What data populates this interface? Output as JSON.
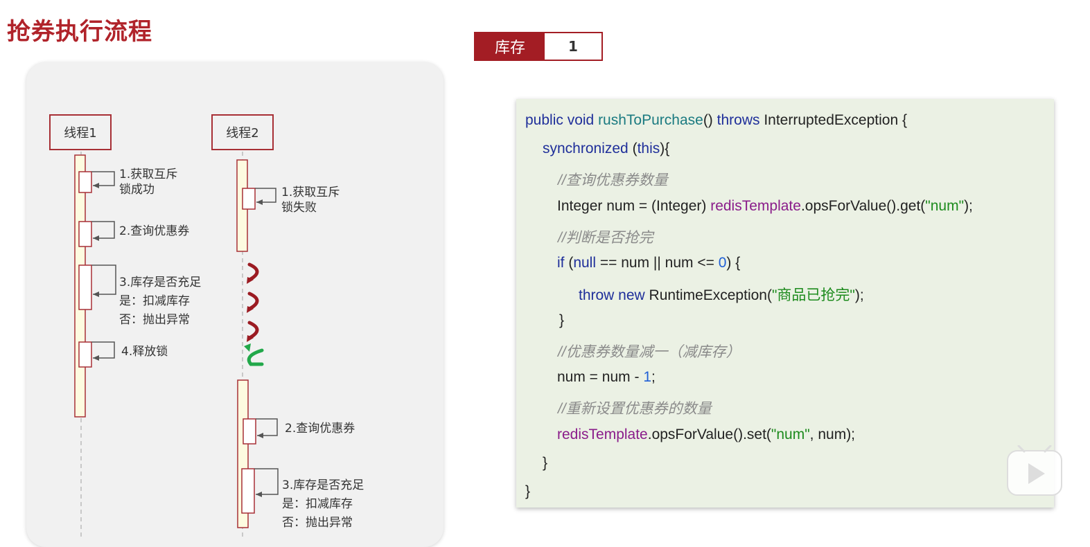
{
  "page": {
    "title": "抢券执行流程"
  },
  "stock": {
    "label": "库存",
    "value": "1"
  },
  "threads": [
    {
      "name": "线程1",
      "steps": [
        {
          "line1": "1.获取互斥",
          "line2": "锁成功"
        },
        {
          "line1": "2.查询优惠券"
        },
        {
          "line1": "3.库存是否充足",
          "line2": "是：扣减库存",
          "line3": "否：抛出异常"
        },
        {
          "line1": "4.释放锁"
        }
      ]
    },
    {
      "name": "线程2",
      "steps": [
        {
          "line1": "1.获取互斥",
          "line2": "锁失败"
        },
        {
          "line1": "2.查询优惠券"
        },
        {
          "line1": "3.库存是否充足",
          "line2": "是：扣减库存",
          "line3": "否：抛出异常"
        }
      ]
    }
  ],
  "colors": {
    "accent": "#a31d24",
    "wait_arrow": "#9b1b22",
    "retry_arrow": "#22a84a",
    "lifeline_fill": "#fdfbe0",
    "code_bg": "#ebf1e4"
  },
  "code": {
    "l1": {
      "kw1": "public void ",
      "fn": "rushToPurchase",
      "p1": "() ",
      "kw2": "throws",
      "p2": " InterruptedException {"
    },
    "l2": {
      "kw": "synchronized",
      "p1": " (",
      "kw2": "this",
      "p2": "){"
    },
    "l3": {
      "cmt": "//查询优惠券数量"
    },
    "l4": {
      "p1": "Integer num = (Integer) ",
      "field": "redisTemplate",
      "p2": ".opsForValue().get(",
      "str": "\"num\"",
      "p3": ");"
    },
    "l5": {
      "cmt": "//判断是否抢完"
    },
    "l6": {
      "kw": "if",
      "p1": " (",
      "kw2": "null",
      "p2": " == num || num <= ",
      "num": "0",
      "p3": ") {"
    },
    "l7": {
      "kw": "throw new",
      "p1": " RuntimeException(",
      "str": "\"商品已抢完\"",
      "p2": ");"
    },
    "l8": {
      "p1": "}"
    },
    "l9": {
      "cmt": "//优惠券数量减一（减库存）"
    },
    "l10": {
      "p1": "num = num - ",
      "num": "1",
      "p2": ";"
    },
    "l11": {
      "cmt": "//重新设置优惠券的数量"
    },
    "l12": {
      "field": "redisTemplate",
      "p1": ".opsForValue().set(",
      "str": "\"num\"",
      "p2": ", num);"
    },
    "l13": {
      "p1": "}"
    },
    "l14": {
      "p1": "}"
    }
  }
}
